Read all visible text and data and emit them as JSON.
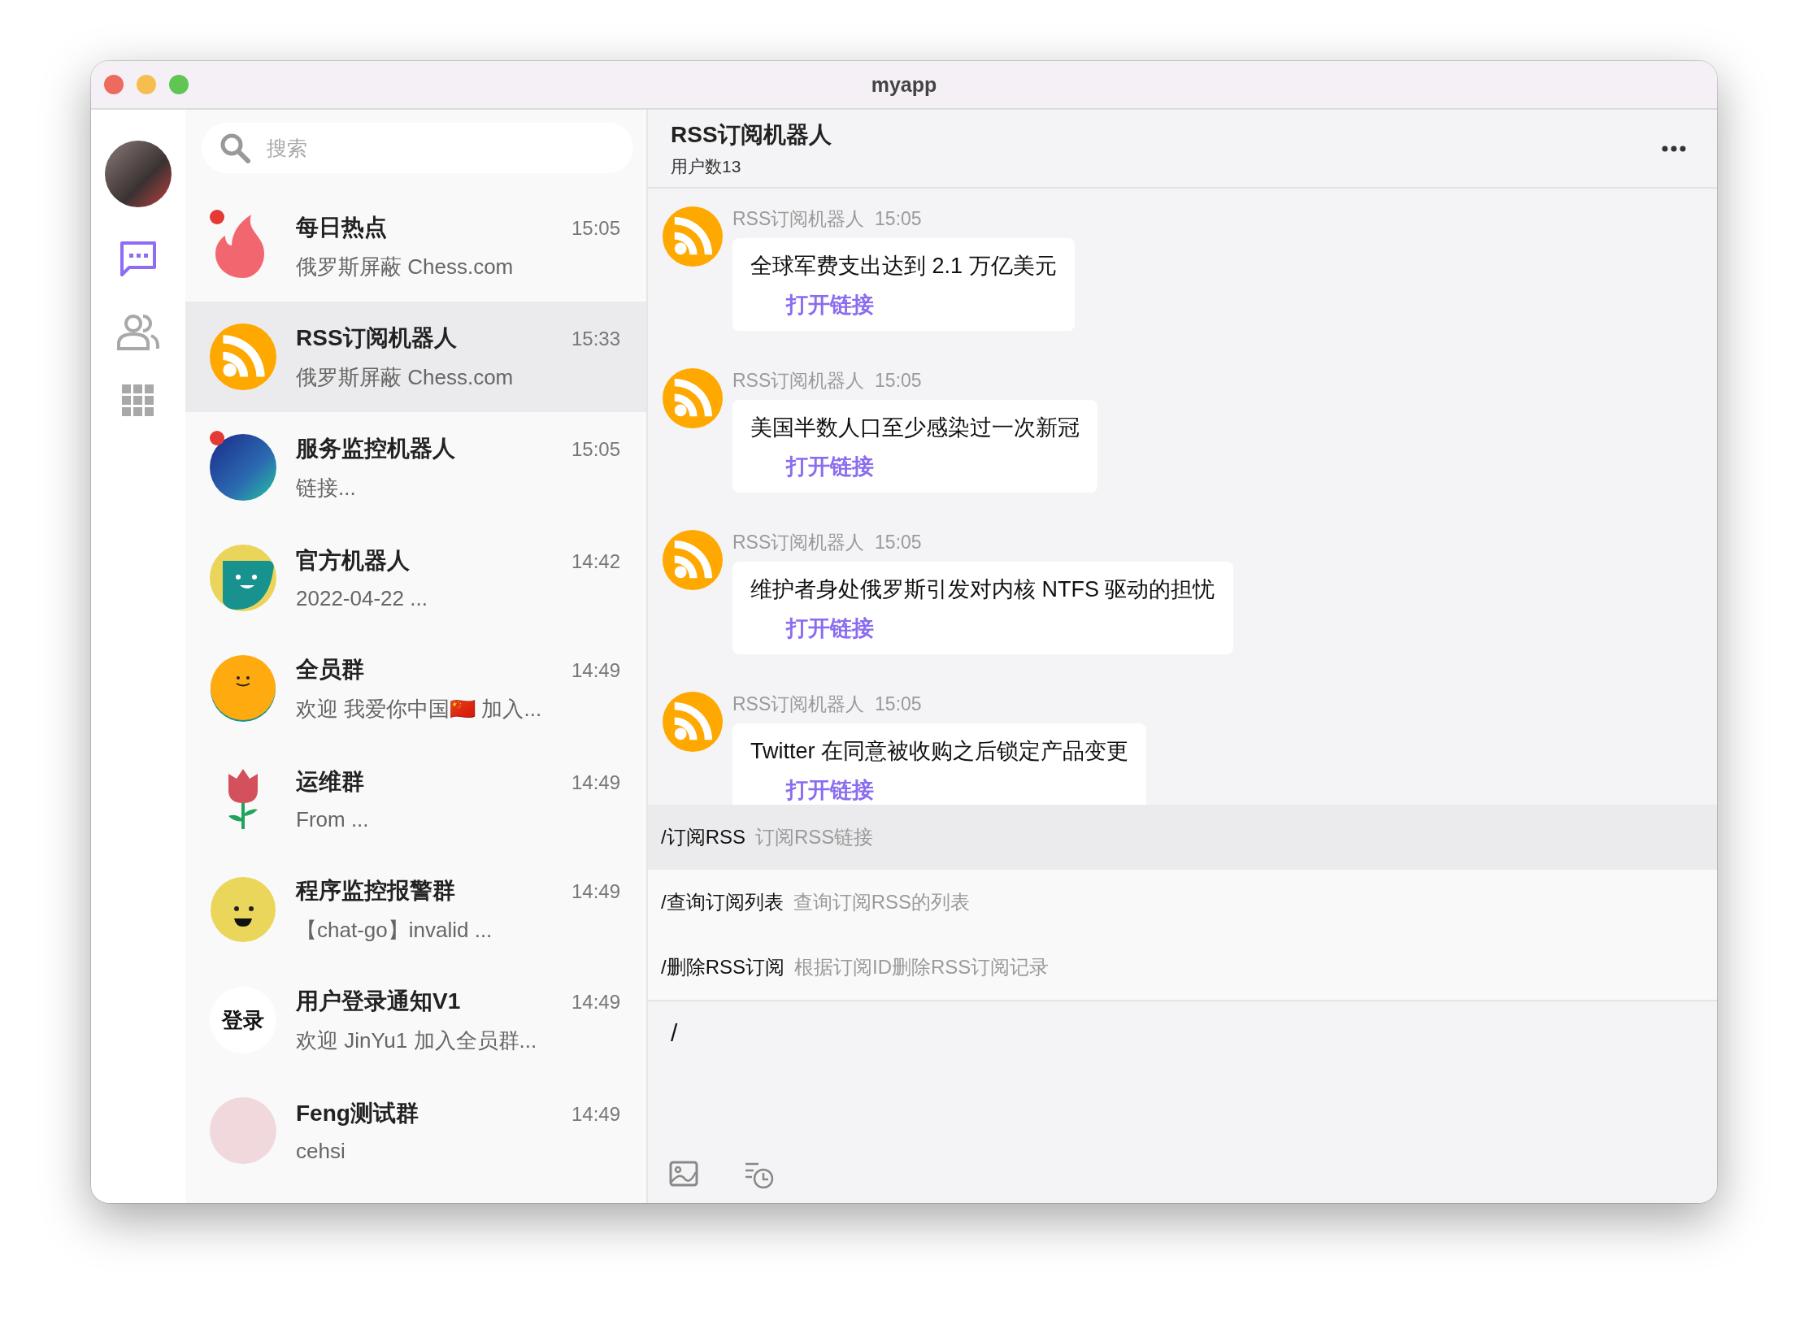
{
  "window": {
    "title": "myapp"
  },
  "nav": [
    {
      "kind": "chat",
      "selected": true
    },
    {
      "kind": "contacts",
      "selected": false
    },
    {
      "kind": "apps",
      "selected": false
    }
  ],
  "search": {
    "placeholder": "搜索"
  },
  "conversations": [
    {
      "name": "每日热点",
      "preview": "俄罗斯屏蔽 Chess.com",
      "time": "15:05",
      "unread": true,
      "selected": false,
      "kind": "fire"
    },
    {
      "name": "RSS订阅机器人",
      "preview": "俄罗斯屏蔽 Chess.com",
      "time": "15:33",
      "unread": false,
      "selected": true,
      "kind": "rss"
    },
    {
      "name": "服务监控机器人",
      "preview": "链接...",
      "time": "15:05",
      "unread": true,
      "selected": false,
      "kind": "galaxy"
    },
    {
      "name": "官方机器人",
      "preview": "2022-04-22 ...",
      "time": "14:42",
      "unread": false,
      "selected": false,
      "kind": "bot"
    },
    {
      "name": "全员群",
      "preview": "欢迎 我爱你中国🇨🇳 加入...",
      "time": "14:49",
      "unread": false,
      "selected": false,
      "kind": "smile"
    },
    {
      "name": "运维群",
      "preview": "From ...",
      "time": "14:49",
      "unread": false,
      "selected": false,
      "kind": "tulip"
    },
    {
      "name": "程序监控报警群",
      "preview": "【chat-go】invalid ...",
      "time": "14:49",
      "unread": false,
      "selected": false,
      "kind": "grin"
    },
    {
      "name": "用户登录通知V1",
      "preview": "欢迎 JinYu1 加入全员群...",
      "time": "14:49",
      "unread": false,
      "selected": false,
      "kind": "text",
      "avatar_text": "登录"
    },
    {
      "name": "Feng测试群",
      "preview": "cehsi",
      "time": "14:49",
      "unread": false,
      "selected": false,
      "kind": "illustration"
    }
  ],
  "chat": {
    "title": "RSS订阅机器人",
    "subtitle": "用户数13",
    "messages": [
      {
        "sender": "RSS订阅机器人",
        "time": "15:05",
        "text": "全球军费支出达到 2.1 万亿美元",
        "link": "打开链接"
      },
      {
        "sender": "RSS订阅机器人",
        "time": "15:05",
        "text": "美国半数人口至少感染过一次新冠",
        "link": "打开链接"
      },
      {
        "sender": "RSS订阅机器人",
        "time": "15:05",
        "text": "维护者身处俄罗斯引发对内核 NTFS 驱动的担忧",
        "link": "打开链接"
      },
      {
        "sender": "RSS订阅机器人",
        "time": "15:05",
        "text": "Twitter 在同意被收购之后锁定产品变更",
        "link": "打开链接"
      }
    ],
    "commands": [
      {
        "command": "/订阅RSS",
        "description": "订阅RSS链接",
        "selected": true
      },
      {
        "command": "/查询订阅列表",
        "description": "查询订阅RSS的列表",
        "selected": false
      },
      {
        "command": "/删除RSS订阅",
        "description": "根据订阅ID删除RSS订阅记录",
        "selected": false
      }
    ],
    "input": {
      "value": "/"
    }
  }
}
